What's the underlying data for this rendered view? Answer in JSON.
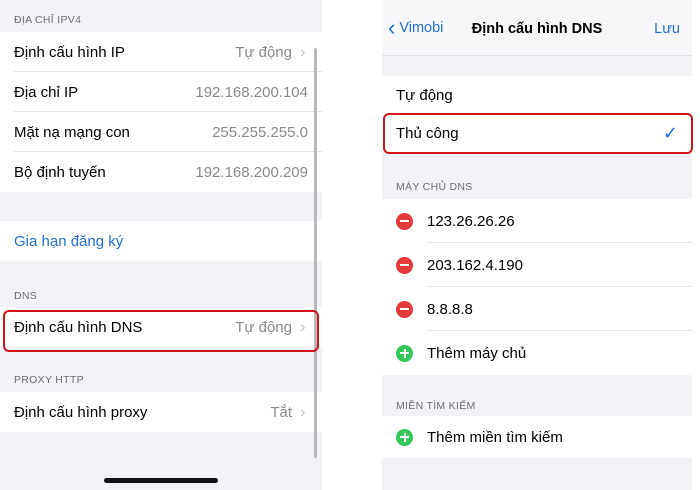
{
  "left": {
    "ipv4_header": "ĐỊA CHỈ IPV4",
    "ip_config": {
      "label": "Định cấu hình IP",
      "value": "Tự động"
    },
    "ip_address": {
      "label": "Địa chỉ IP",
      "value": "192.168.200.104"
    },
    "subnet": {
      "label": "Mặt nạ mạng con",
      "value": "255.255.255.0"
    },
    "router": {
      "label": "Bộ định tuyến",
      "value": "192.168.200.209"
    },
    "renew_lease": "Gia hạn đăng ký",
    "dns_header": "DNS",
    "dns_config": {
      "label": "Định cấu hình DNS",
      "value": "Tự động"
    },
    "proxy_header": "PROXY HTTP",
    "proxy_config": {
      "label": "Định cấu hình proxy",
      "value": "Tắt"
    }
  },
  "right": {
    "nav": {
      "back": "Vimobi",
      "title": "Định cấu hình DNS",
      "save": "Lưu"
    },
    "modes": {
      "automatic": "Tự động",
      "manual": "Thủ công"
    },
    "dns_servers_header": "MÁY CHỦ DNS",
    "dns_servers": [
      "123.26.26.26",
      "203.162.4.190",
      "8.8.8.8"
    ],
    "add_server": "Thêm máy chủ",
    "search_domains_header": "MIỀN TÌM KIẾM",
    "add_search_domain": "Thêm miền tìm kiếm"
  },
  "colors": {
    "accent": "#1f6fd6",
    "highlight": "#d0141b",
    "delete": "#e5393b",
    "add": "#34c759"
  }
}
